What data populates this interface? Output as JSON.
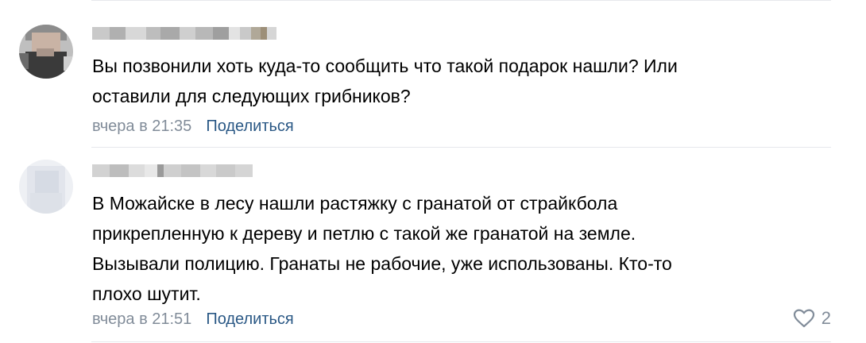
{
  "comments": [
    {
      "text_lines": [
        "Вы позвонили хоть куда-то сообщить что такой подарок нашли? Или",
        "оставили для следующих грибников?"
      ],
      "time": "вчера в 21:35",
      "share_label": "Поделиться"
    },
    {
      "text_lines": [
        "В Можайске в лесу нашли растяжку с гранатой от страйкбола",
        "прикрепленную к дереву и петлю с такой же гранатой на земле.",
        "Вызывали полицию. Гранаты не рабочие, уже использованы. Кто-то",
        "плохо шутит."
      ],
      "time": "вчера в 21:51",
      "share_label": "Поделиться",
      "like_count": "2",
      "like_icon": "heart-outline-icon"
    }
  ],
  "colors": {
    "link": "#2a5885",
    "meta": "#818c99",
    "divider": "#e7e8ec"
  }
}
